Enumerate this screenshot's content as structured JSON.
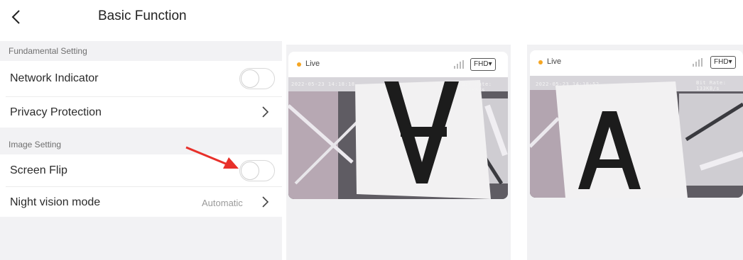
{
  "header": {
    "title": "Basic Function"
  },
  "sections": {
    "fundamental": "Fundamental Setting",
    "image": "Image Setting"
  },
  "rows": {
    "network_indicator": {
      "label": "Network Indicator",
      "toggle_on": false
    },
    "privacy_protection": {
      "label": "Privacy Protection"
    },
    "screen_flip": {
      "label": "Screen Flip",
      "toggle_on": false
    },
    "night_vision": {
      "label": "Night vision mode",
      "value": "Automatic"
    }
  },
  "previews": [
    {
      "live": "Live",
      "quality": "FHD",
      "timestamp": "2022-05-23 14:18:18",
      "bitrate": "Bit Rate: 153KB/s",
      "letter": "A",
      "flipped": true
    },
    {
      "live": "Live",
      "quality": "FHD",
      "timestamp": "2022-05-23 14:18:52",
      "bitrate": "Bit Rate: 133KB/s",
      "letter": "A",
      "flipped": false
    }
  ],
  "colors": {
    "live_dot": "#f5a623",
    "annotation_arrow": "#e8302a",
    "section_bg": "#f2f2f4"
  },
  "icons": [
    "back-arrow-icon",
    "chevron-right-icon",
    "signal-icon",
    "dropdown-caret-icon",
    "annotation-arrow"
  ]
}
